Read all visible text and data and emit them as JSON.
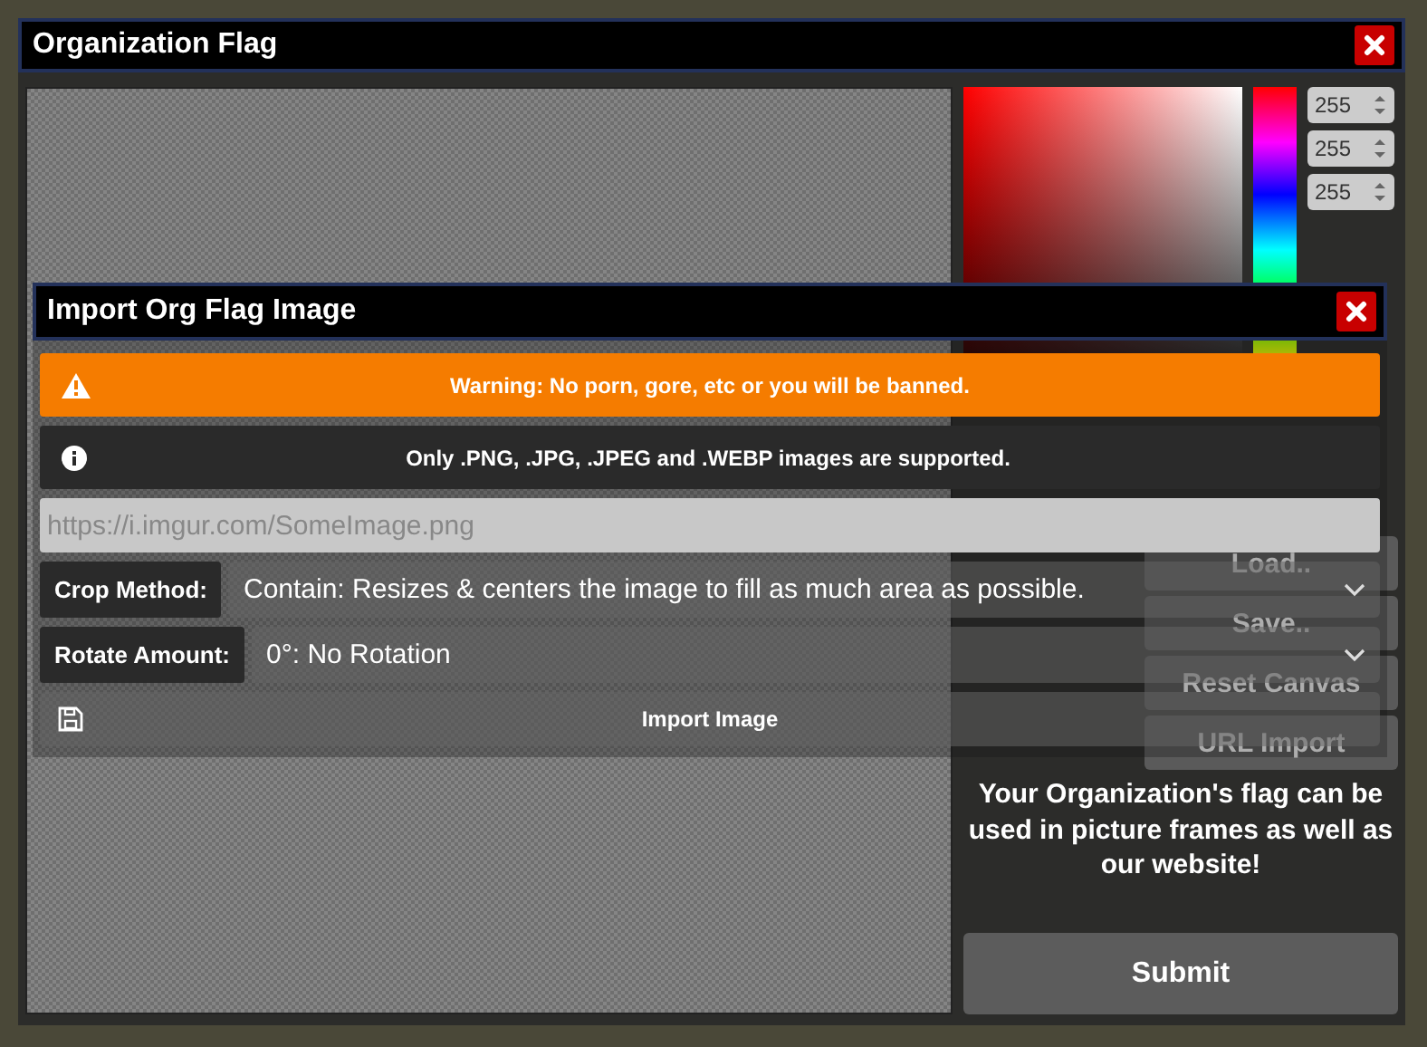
{
  "window": {
    "title": "Organization Flag"
  },
  "color_picker": {
    "values": [
      "255",
      "255",
      "255"
    ]
  },
  "side_buttons": [
    "Load..",
    "Save..",
    "Reset Canvas",
    "URL Import"
  ],
  "note": "Your Organization's flag can be used in picture frames as well as our website!",
  "submit": "Submit",
  "dialog": {
    "title": "Import Org Flag Image",
    "alerts": [
      {
        "kind": "warning",
        "text": "Warning: No porn, gore, etc or you will be banned."
      },
      {
        "kind": "info",
        "text": "Only .PNG, .JPG, .JPEG and .WEBP images are supported."
      }
    ],
    "url_field": {
      "placeholder": "https://i.imgur.com/SomeImage.png"
    },
    "selects": [
      {
        "label": "Crop Method:",
        "value": "Contain: Resizes & centers the image to fill as much area as possible."
      },
      {
        "label": "Rotate Amount:",
        "value": "0°: No Rotation"
      }
    ],
    "import_button": "Import Image"
  }
}
